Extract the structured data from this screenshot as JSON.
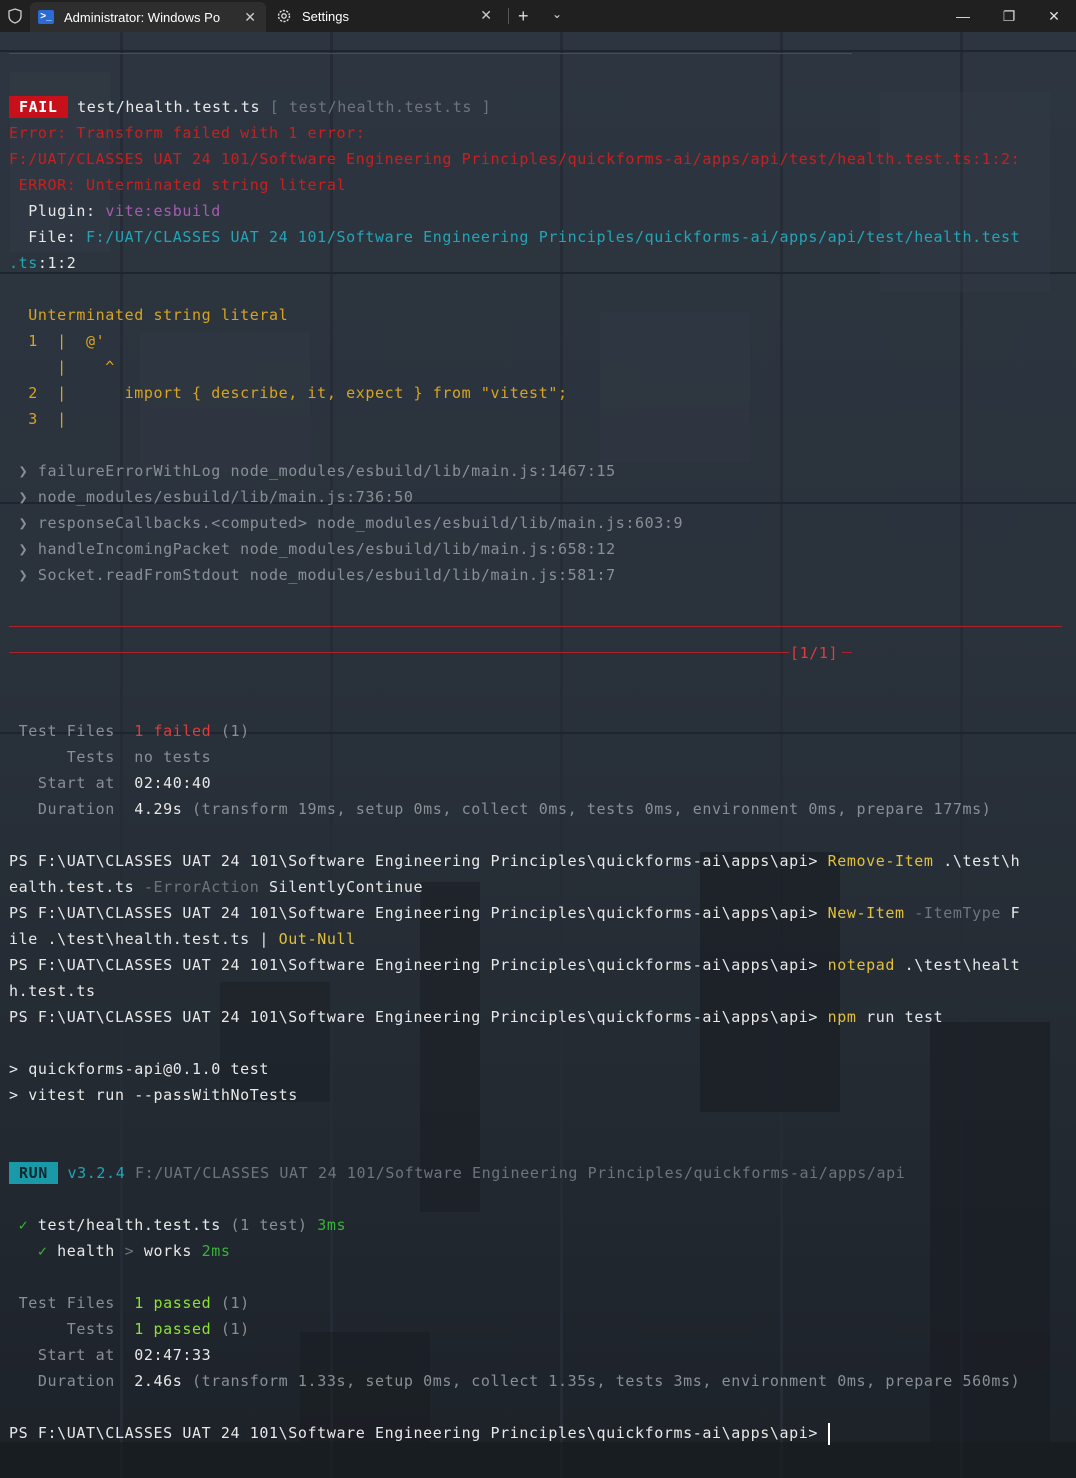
{
  "window": {
    "tabs": [
      {
        "label": "Administrator: Windows Po"
      },
      {
        "label": "Settings"
      }
    ]
  },
  "terminal": {
    "fail_badge": "FAIL",
    "fail_file": "test/health.test.ts",
    "fail_file_bracket": "[ test/health.test.ts ]",
    "error_line": "Error: Transform failed with 1 error:",
    "error_path": "F:/UAT/CLASSES UAT 24 101/Software Engineering Principles/quickforms-ai/apps/api/test/health.test.ts:1:2:",
    "error_msg": " ERROR: Unterminated string literal",
    "plugin_label": "  Plugin: ",
    "plugin_value": "vite:esbuild",
    "file_label": "  File: ",
    "file_value": "F:/UAT/CLASSES UAT 24 101/Software Engineering Principles/quickforms-ai/apps/api/test/health.test",
    "file_value2": ".ts",
    "file_value2_rest": ":1:2",
    "code_title": "  Unterminated string literal",
    "code_1": "  1  |  @'",
    "code_caret": "     |    ^",
    "code_2": "  2  |      import { describe, it, expect } from \"vitest\";",
    "code_3": "  3  |",
    "stack": [
      " ❯ failureErrorWithLog node_modules/esbuild/lib/main.js:1467:15",
      " ❯ node_modules/esbuild/lib/main.js:736:50",
      " ❯ responseCallbacks.<computed> node_modules/esbuild/lib/main.js:603:9",
      " ❯ handleIncomingPacket node_modules/esbuild/lib/main.js:658:12",
      " ❯ Socket.readFromStdout node_modules/esbuild/lib/main.js:581:7"
    ],
    "counter": "[1/1]",
    "summary1": {
      "test_files_label": " Test Files  ",
      "test_files_value": "1 failed",
      "test_files_count": " (1)",
      "tests_label": "      Tests  ",
      "tests_value": "no tests",
      "start_label": "   Start at  ",
      "start_value": "02:40:40",
      "duration_label": "   Duration  ",
      "duration_value": "4.29s",
      "duration_detail": " (transform 19ms, setup 0ms, collect 0ms, tests 0ms, environment 0ms, prepare 177ms)"
    },
    "prompt": "PS F:\\UAT\\CLASSES UAT 24 101\\Software Engineering Principles\\quickforms-ai\\apps\\api> ",
    "cmd1": "Remove-Item",
    "cmd1_rest": " .\\test\\h",
    "cmd1_wrap_a": "ealth.test.ts ",
    "cmd1_param": "-ErrorAction",
    "cmd1_wrap_b": " SilentlyContinue",
    "cmd2": "New-Item",
    "cmd2_param": " -ItemType",
    "cmd2_rest": " F",
    "cmd2_wrap_a": "ile .\\test\\health.test.ts | ",
    "cmd2_wrap_b": "Out-Null",
    "cmd3": "notepad",
    "cmd3_rest": " .\\test\\healt",
    "cmd3_wrap": "h.test.ts",
    "cmd4": "npm",
    "cmd4_rest": " run test",
    "npm1": "> quickforms-api@0.1.0 test",
    "npm2": "> vitest run --passWithNoTests",
    "run_badge": "RUN",
    "run_version": " v3.2.4",
    "run_path": " F:/UAT/CLASSES UAT 24 101/Software Engineering Principles/quickforms-ai/apps/api",
    "pass_check": " ✓ ",
    "pass_file": "test/health.test.ts",
    "pass_count": " (1 test)",
    "pass_time": " 3ms",
    "sub_check": "   ✓ ",
    "sub_a": "health",
    "sub_sep": " > ",
    "sub_b": "works",
    "sub_time": " 2ms",
    "summary2": {
      "test_files_label": " Test Files  ",
      "test_files_value": "1 passed",
      "test_files_count": " (1)",
      "tests_label": "      Tests  ",
      "tests_value": "1 passed",
      "tests_count": " (1)",
      "start_label": "   Start at  ",
      "start_value": "02:47:33",
      "duration_label": "   Duration  ",
      "duration_value": "2.46s",
      "duration_detail": " (transform 1.33s, setup 0ms, collect 1.35s, tests 3ms, environment 0ms, prepare 560ms)"
    },
    "final_prompt": "PS F:\\UAT\\CLASSES UAT 24 101\\Software Engineering Principles\\quickforms-ai\\apps\\api> "
  }
}
